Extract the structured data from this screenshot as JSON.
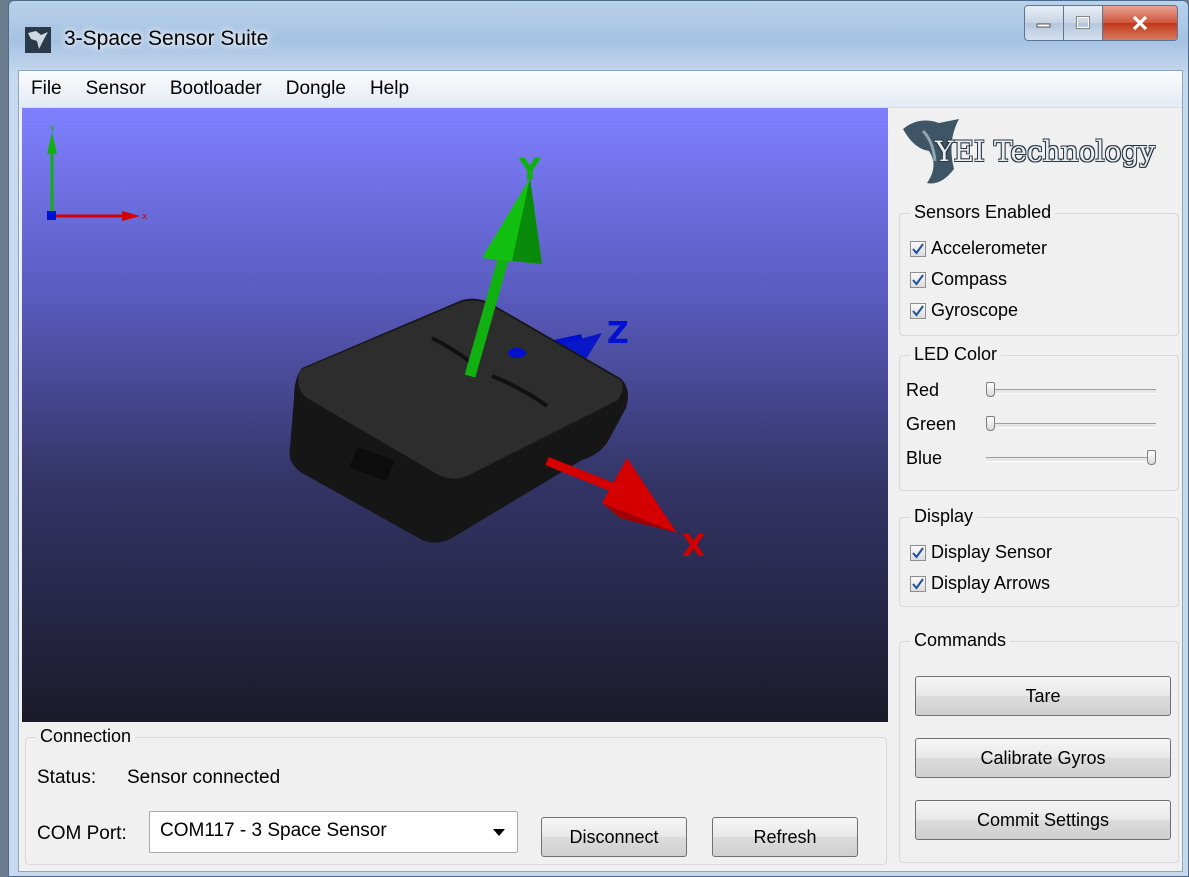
{
  "window": {
    "title": "3-Space Sensor Suite"
  },
  "menu": {
    "items": [
      "File",
      "Sensor",
      "Bootloader",
      "Dongle",
      "Help"
    ]
  },
  "viewport": {
    "axis_labels": {
      "x": "X",
      "y": "Y",
      "z": "Z"
    },
    "mini_axis_labels": {
      "x": "x",
      "y": "y"
    }
  },
  "logo": {
    "text": "YEI Technology"
  },
  "sensors": {
    "title": "Sensors Enabled",
    "items": [
      {
        "label": "Accelerometer",
        "checked": true
      },
      {
        "label": "Compass",
        "checked": true
      },
      {
        "label": "Gyroscope",
        "checked": true
      }
    ]
  },
  "led": {
    "title": "LED Color",
    "channels": [
      {
        "label": "Red",
        "value": 0
      },
      {
        "label": "Green",
        "value": 0
      },
      {
        "label": "Blue",
        "value": 1
      }
    ]
  },
  "display": {
    "title": "Display",
    "items": [
      {
        "label": "Display Sensor",
        "checked": true
      },
      {
        "label": "Display Arrows",
        "checked": true
      }
    ]
  },
  "commands": {
    "title": "Commands",
    "tare": "Tare",
    "calibrate": "Calibrate Gyros",
    "commit": "Commit Settings"
  },
  "connection": {
    "title": "Connection",
    "status_label": "Status:",
    "status_value": "Sensor connected",
    "port_label": "COM Port:",
    "port_value": "COM117 - 3 Space Sensor",
    "disconnect": "Disconnect",
    "refresh": "Refresh"
  },
  "colors": {
    "x_axis": "#d40000",
    "y_axis": "#10b010",
    "z_axis": "#0010d0",
    "viewport_top": "#7f80ff",
    "viewport_bottom": "#1a1a2a"
  }
}
